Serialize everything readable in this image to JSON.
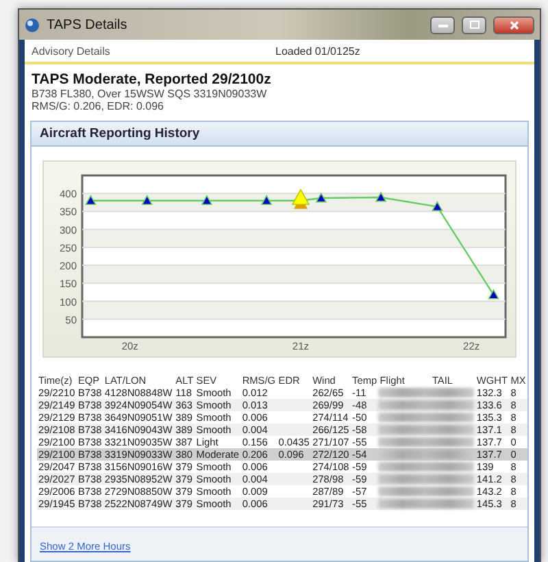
{
  "window": {
    "title": "TAPS Details"
  },
  "header": {
    "label": "Advisory Details",
    "loaded": "Loaded 01/0125z"
  },
  "advisory": {
    "title": "TAPS Moderate, Reported 29/2100z",
    "lines": [
      "B738 FL380, Over 15WSW SQS 3319N09033W",
      "RMS/G: 0.206, EDR: 0.096"
    ]
  },
  "panel": {
    "title": "Aircraft Reporting History",
    "chart_data": {
      "type": "line",
      "x": [
        19.77,
        20.1,
        20.45,
        20.8,
        21,
        21.12,
        21.47,
        21.8,
        22.13
      ],
      "series": [
        {
          "color": "#66cc66",
          "marker": "triangle",
          "values": [
            380,
            380,
            380,
            380,
            null,
            387,
            389,
            363,
            118
          ]
        },
        {
          "color": "#ffff00",
          "marker": "triangle",
          "values": [
            null,
            null,
            null,
            null,
            380,
            null,
            null,
            null,
            null
          ]
        }
      ],
      "grid": true,
      "xlim": [
        19.72,
        22.2
      ],
      "ylim": [
        0,
        450
      ],
      "xticks": [
        {
          "value": 20,
          "label": "20z"
        },
        {
          "value": 21,
          "label": "21z"
        },
        {
          "value": 22,
          "label": "22z"
        }
      ],
      "yticks": [
        50,
        100,
        150,
        200,
        250,
        300,
        350,
        400
      ]
    },
    "table": {
      "columns": [
        "Time(z)",
        "EQP",
        "LAT/LON",
        "ALT",
        "SEV",
        "RMS/G",
        "EDR",
        "Wind",
        "Temp",
        "Flight",
        "TAIL",
        "WGHT",
        "MX"
      ],
      "rows": [
        {
          "selected": false,
          "redacted": true,
          "cells": [
            "29/2210",
            "B738",
            "4128N08848W",
            "118",
            "Smooth",
            "0.012",
            null,
            "262/65",
            "-11",
            "132.3",
            "8"
          ]
        },
        {
          "selected": false,
          "redacted": true,
          "cells": [
            "29/2149",
            "B738",
            "3924N09054W",
            "363",
            "Smooth",
            "0.013",
            null,
            "269/99",
            "-48",
            "133.6",
            "8"
          ]
        },
        {
          "selected": false,
          "redacted": true,
          "cells": [
            "29/2129",
            "B738",
            "3649N09051W",
            "389",
            "Smooth",
            "0.006",
            null,
            "274/114",
            "-50",
            "135.3",
            "8"
          ]
        },
        {
          "selected": false,
          "redacted": true,
          "cells": [
            "29/2108",
            "B738",
            "3416N09043W",
            "389",
            "Smooth",
            "0.004",
            null,
            "266/125",
            "-58",
            "137.1",
            "8"
          ]
        },
        {
          "selected": false,
          "redacted": true,
          "cells": [
            "29/2100",
            "B738",
            "3321N09035W",
            "387",
            "Light",
            "0.156",
            "0.0435",
            "271/107",
            "-55",
            "137.7",
            "0"
          ]
        },
        {
          "selected": true,
          "redacted": true,
          "cells": [
            "29/2100",
            "B738",
            "3319N09033W",
            "380",
            "Moderate",
            "0.206",
            "0.096",
            "272/120",
            "-54",
            "137.7",
            "0"
          ]
        },
        {
          "selected": false,
          "redacted": true,
          "cells": [
            "29/2047",
            "B738",
            "3156N09016W",
            "379",
            "Smooth",
            "0.006",
            null,
            "274/108",
            "-59",
            "139",
            "8"
          ]
        },
        {
          "selected": false,
          "redacted": true,
          "cells": [
            "29/2027",
            "B738",
            "2935N08952W",
            "379",
            "Smooth",
            "0.004",
            null,
            "278/98",
            "-59",
            "141.2",
            "8"
          ]
        },
        {
          "selected": false,
          "redacted": true,
          "cells": [
            "29/2006",
            "B738",
            "2729N08850W",
            "379",
            "Smooth",
            "0.009",
            null,
            "287/89",
            "-57",
            "143.2",
            "8"
          ]
        },
        {
          "selected": false,
          "redacted": true,
          "cells": [
            "29/1945",
            "B738",
            "2522N08749W",
            "379",
            "Smooth",
            "0.006",
            null,
            "291/73",
            "-55",
            "145.3",
            "8"
          ]
        }
      ]
    },
    "footer_link": "Show 2 More Hours"
  }
}
